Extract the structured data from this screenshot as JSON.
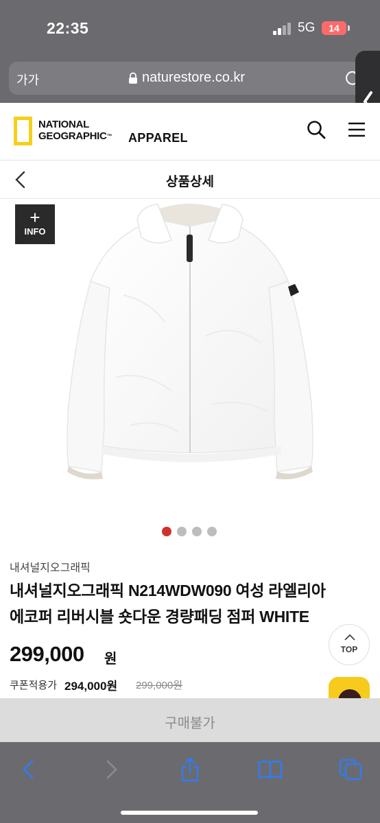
{
  "status_bar": {
    "time": "22:35",
    "network": "5G",
    "battery": "14"
  },
  "browser": {
    "text_size_label": "가가",
    "url": "naturestore.co.kr"
  },
  "site_header": {
    "logo_line1": "NATIONAL",
    "logo_line2": "GEOGRAPHIC",
    "logo_tm": "™",
    "section": "APPAREL",
    "brand_color": "#f6cf1a"
  },
  "title_bar": {
    "title": "상품상세"
  },
  "product": {
    "info_badge_plus": "+",
    "info_badge_label": "INFO",
    "carousel": {
      "total": 4,
      "active_index": 0,
      "active_color": "#d0312d"
    },
    "brand": "내셔널지오그래픽",
    "name_line1": "내셔널지오그래픽 N214WDW090 여성 라엘리아",
    "name_line2": "에코퍼 리버시블 숏다운 경량패딩 점퍼 WHITE",
    "price": "299,000",
    "price_unit": "원",
    "coupon_label": "쿠폰적용가",
    "coupon_price": "294,000원",
    "original_price": "299,000원"
  },
  "floating": {
    "top_label": "TOP"
  },
  "buy_bar": {
    "label": "구매불가"
  },
  "icons": [
    "lock-icon",
    "reload-icon",
    "search-icon",
    "menu-icon",
    "back-icon",
    "share-icon",
    "bookmarks-icon",
    "tabs-icon"
  ]
}
